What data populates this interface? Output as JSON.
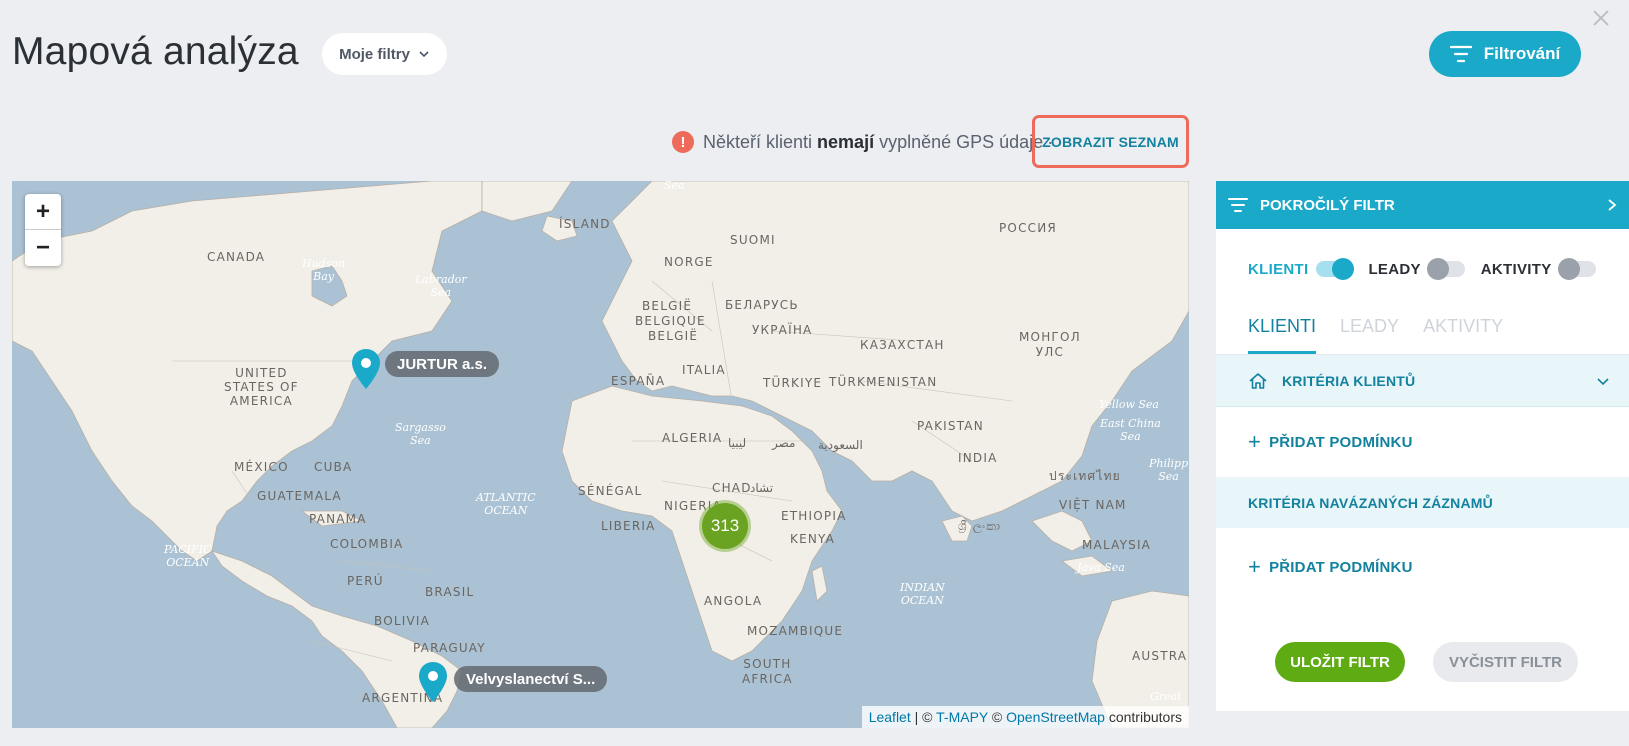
{
  "page": {
    "title": "Mapová analýza",
    "my_filters": "Moje filtry",
    "filter_button": "Filtrování"
  },
  "notice": {
    "part1": "Někteří klienti",
    "bold": "nemají",
    "part2": "vyplněné GPS údaje",
    "separator": "·",
    "link": "ZOBRAZIT SEZNAM"
  },
  "map": {
    "zoom_in": "+",
    "zoom_out": "−",
    "cluster_count": "313",
    "markers": [
      {
        "label": "JURTUR a.s."
      },
      {
        "label": "Velvyslanectví S..."
      }
    ],
    "attribution": {
      "leaflet": "Leaflet",
      "sep": " | © ",
      "tmapy": "T-MAPY",
      "copy": " © ",
      "osm": "OpenStreetMap",
      "contributors": " contributors"
    },
    "labels": {
      "canada": "CANADA",
      "us": "UNITED\nSTATES OF\nAMERICA",
      "mexico": "MÉXICO",
      "cuba": "CUBA",
      "guatemala": "GUATEMALA",
      "panama": "PANAMA",
      "colombia": "COLOMBIA",
      "peru": "PERÚ",
      "brasil": "BRASIL",
      "bolivia": "BOLIVIA",
      "paraguay": "PARAGUAY",
      "argentina": "ARGENTINA",
      "island": "ÍSLAND",
      "norge": "NORGE",
      "suomi": "SUOMI",
      "rossiya": "РОССИЯ",
      "belgie1": "BELGIË",
      "belgie2": "BELGIQUE",
      "belgie3": "BELGIË",
      "belarus": "БЕЛАРУСЬ",
      "ukraina": "УКРАЇНА",
      "kazakhstan": "КАЗАХСТАН",
      "mongol": "МОНГОЛ\nУЛС",
      "espana": "ESPAÑA",
      "italia": "ITALIA",
      "turkiye": "TÜRKIYE",
      "turkmenistan": "TÜRKMENISTAN",
      "pakistan": "PAKISTAN",
      "india": "INDIA",
      "algeria": "ALGERIA",
      "libya": "ليبيا",
      "egypt": "مصر",
      "saudi": "السعودية",
      "chad": "CHAD",
      "tchad": "تشاد",
      "senegal": "SÉNÉGAL",
      "nigeria": "NIGERIA",
      "liberia": "LIBERIA",
      "ethiopia": "ETHIOPIA",
      "kenya": "KENYA",
      "angola": "ANGOLA",
      "mozambique": "MOZAMBIQUE",
      "south_africa": "SOUTH\nAFRICA",
      "thailand": "ประเทศไทย",
      "vietnam": "VIỆT NAM",
      "malaysia": "MALAYSIA",
      "srilanka": "ශ්‍රී ලංකා",
      "austra": "AUSTRA",
      "hudson": "Hudson\nBay",
      "labrador": "Labrador\nSea",
      "sargasso": "Sargasso\nSea",
      "atlantic": "ATLANTIC\nOCEAN",
      "pacific": "PACIFIC\nOCEAN",
      "indian": "INDIAN\nOCEAN",
      "yellow": "Yellow Sea",
      "eastchina": "East China\nSea",
      "philipp": "Philipp\nSea",
      "java": "Java Sea",
      "great": "Great",
      "sea_top": "Sea"
    }
  },
  "panel": {
    "header": "POKROČILÝ FILTR",
    "toggles": [
      {
        "label": "KLIENTI",
        "on": true
      },
      {
        "label": "LEADY",
        "on": false
      },
      {
        "label": "AKTIVITY",
        "on": false
      }
    ],
    "tabs": [
      {
        "label": "KLIENTI",
        "active": true
      },
      {
        "label": "LEADY",
        "active": false
      },
      {
        "label": "AKTIVITY",
        "active": false
      }
    ],
    "client_criteria": "KRITÉRIA KLIENTŮ",
    "add_condition_1": "PŘIDAT PODMÍNKU",
    "linked_criteria": "KRITÉRIA NAVÁZANÝCH ZÁZNAMŮ",
    "add_condition_2": "PŘIDAT PODMÍNKU",
    "save": "ULOŽIT FILTR",
    "clear": "VYČISTIT FILTR"
  },
  "colors": {
    "accent": "#1ba9c9",
    "accent_dark": "#13829f",
    "warning": "#ee6a5a",
    "cluster": "#6aa321",
    "save": "#5fab14",
    "water": "#aac2d4",
    "land": "#f2efe9"
  }
}
